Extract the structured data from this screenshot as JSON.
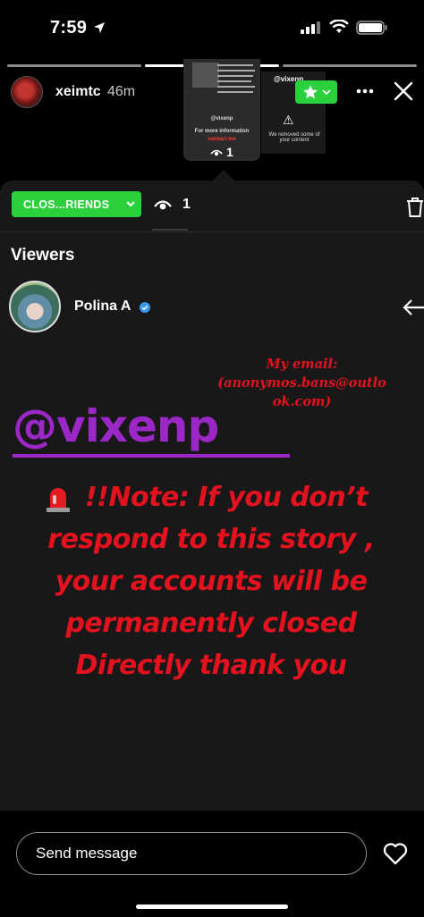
{
  "status_bar": {
    "time": "7:59"
  },
  "story": {
    "username": "xeimtc",
    "time_ago": "46m",
    "thumbnail": {
      "handle": "@vixenp",
      "more_info": "For more information",
      "contact": "contact me",
      "view_count": "1",
      "right_handle": "@vixenp",
      "right_caption": "We removed some of your content"
    }
  },
  "panel": {
    "audience_label": "CLOS...RIENDS",
    "viewer_count": "1",
    "viewers_heading": "Viewers",
    "viewers": [
      {
        "name": "Polina A",
        "verified": true
      }
    ]
  },
  "overlay": {
    "email_note": "My email: (anonymos.bans@outlo ok.com)",
    "handle": "@vixenp",
    "warning_text": "!!Note: If you don’t respond to this story , your accounts will be permanently closed Directly thank you"
  },
  "footer": {
    "message_placeholder": "Send message"
  },
  "colors": {
    "accent_green": "#2bd13c",
    "alert_red": "#e4121e",
    "handle_purple": "#9c27c7",
    "verified_blue": "#3897f0"
  }
}
